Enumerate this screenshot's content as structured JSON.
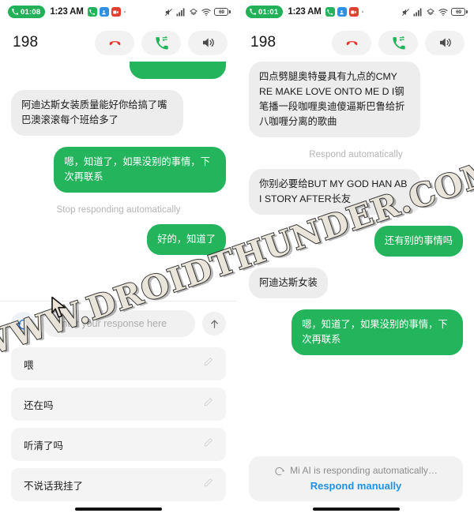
{
  "watermark": {
    "text": "WWW.DROIDTHUNDER.COM"
  },
  "left": {
    "status_bar": {
      "call_timer": "01:08",
      "clock": "1:23 AM",
      "app_icons": [
        "phone-app-icon",
        "contacts-app-icon",
        "camera-app-icon"
      ],
      "right_icons": [
        "mute-icon",
        "signal-icon",
        "data-icon",
        "wifi-icon"
      ],
      "battery_percent": "69"
    },
    "header": {
      "number": "198",
      "buttons": [
        {
          "name": "end-call-button",
          "icon": "phone-hangup-icon"
        },
        {
          "name": "transfer-call-button",
          "icon": "phone-transfer-icon"
        },
        {
          "name": "speaker-button",
          "icon": "speaker-icon"
        }
      ]
    },
    "messages": [
      {
        "side": "out",
        "text": "",
        "clipped": true
      },
      {
        "side": "in",
        "text": "阿迪达斯女装质量能好你给搞了嘴巴澳滚滚每个班给多了"
      },
      {
        "side": "out",
        "text": "嗯，知道了，如果没别的事情，下次再联系"
      }
    ],
    "system_note": "Stop responding automatically",
    "messages_after_note": [
      {
        "side": "out",
        "text": "好的，知道了"
      }
    ],
    "input": {
      "mic_icon": "headset-icon",
      "placeholder": "Enter your response here",
      "value": "",
      "send_icon": "send-arrow-up-icon"
    },
    "suggestions": [
      {
        "label": "喂",
        "edit_icon": "pencil-edit-icon"
      },
      {
        "label": "还在吗",
        "edit_icon": "pencil-edit-icon"
      },
      {
        "label": "听清了吗",
        "edit_icon": "pencil-edit-icon"
      },
      {
        "label": "不说话我挂了",
        "edit_icon": "pencil-edit-icon"
      }
    ]
  },
  "right": {
    "status_bar": {
      "call_timer": "01:01",
      "clock": "1:23 AM",
      "app_icons": [
        "phone-app-icon",
        "contacts-app-icon",
        "camera-app-icon"
      ],
      "right_icons": [
        "mute-icon",
        "signal-icon",
        "data-icon",
        "wifi-icon"
      ],
      "battery_percent": "69"
    },
    "header": {
      "number": "198",
      "buttons": [
        {
          "name": "end-call-button",
          "icon": "phone-hangup-icon"
        },
        {
          "name": "transfer-call-button",
          "icon": "phone-transfer-icon"
        },
        {
          "name": "speaker-button",
          "icon": "speaker-icon"
        }
      ]
    },
    "messages": [
      {
        "side": "in",
        "text": "四点劈腿奥特曼具有九点的CMY RE MAKE LOVE ONTO ME D I钢笔播一段咖喱奥迪傻逼斯巴鲁给折八咖喱分离的歌曲"
      }
    ],
    "system_note": "Respond automatically",
    "messages_after_note": [
      {
        "side": "in",
        "text": "你别必要给BUT MY GOD HAN AB I STORY AFTER长友"
      },
      {
        "side": "out",
        "text": "还有别的事情吗"
      },
      {
        "side": "in",
        "text": "阿迪达斯女装"
      },
      {
        "side": "out",
        "text": "嗯，知道了，如果没别的事情，下次再联系"
      }
    ],
    "ai_banner": {
      "icon": "refresh-spinner-icon",
      "status_text": "Mi AI is responding automatically…",
      "action_label": "Respond manually"
    }
  }
}
